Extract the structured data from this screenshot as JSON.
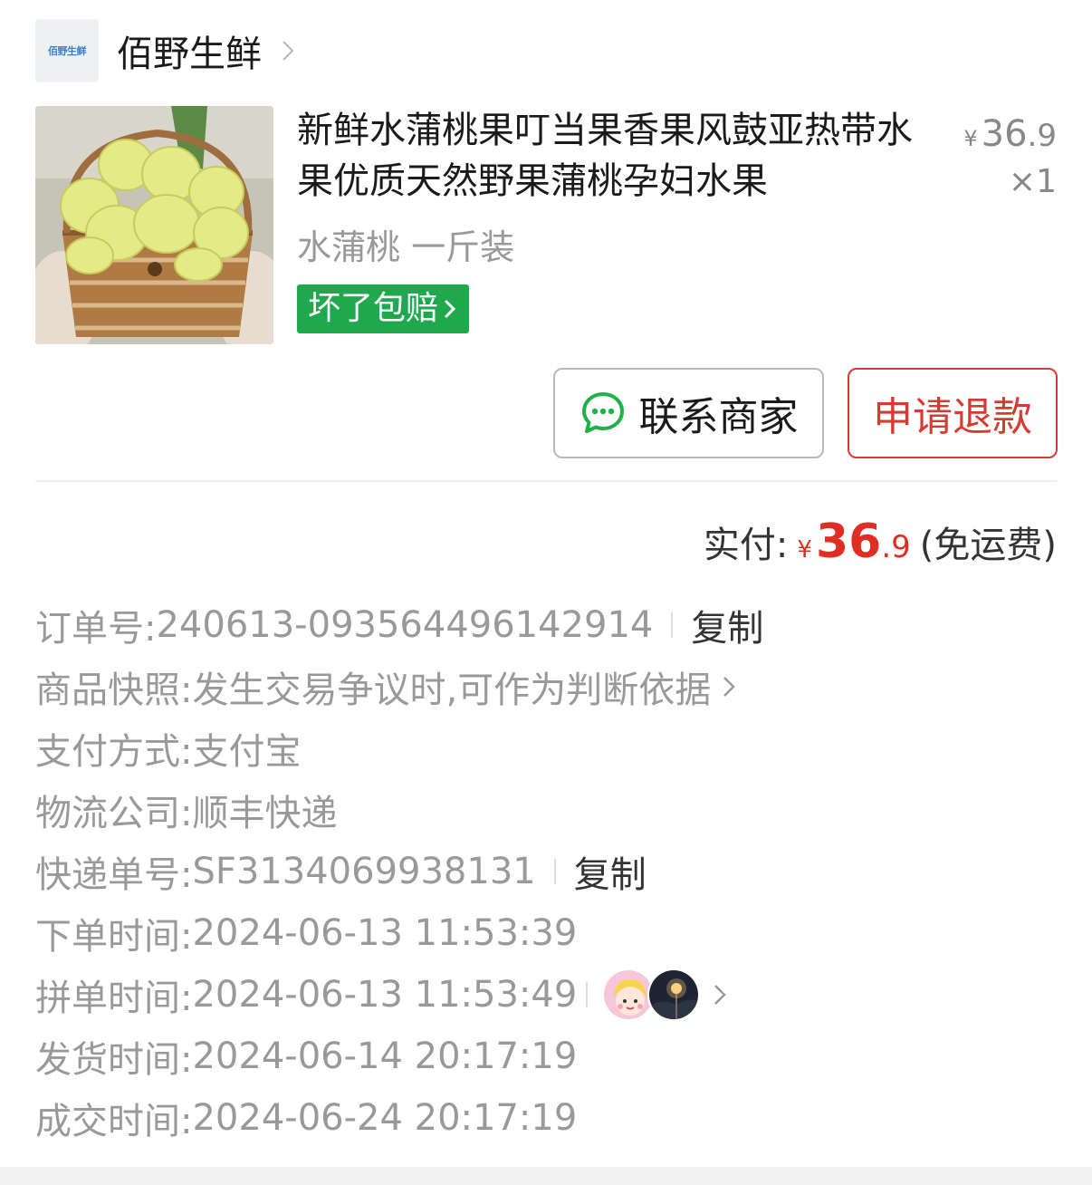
{
  "store": {
    "logo_text": "佰野生鲜",
    "name": "佰野生鲜"
  },
  "product": {
    "title": "新鲜水蒲桃果叮当果香果风鼓亚热带水果优质天然野果蒲桃孕妇水果",
    "price_yen": "¥",
    "price_int": "36",
    "price_dec": ".9",
    "quantity": "×1",
    "spec": "水蒲桃 一斤装",
    "guarantee": "坏了包赔"
  },
  "actions": {
    "contact": "联系商家",
    "refund": "申请退款"
  },
  "payment": {
    "label": "实付:",
    "yen": "¥",
    "int": "36",
    "dec": ".9",
    "note": "(免运费)"
  },
  "info": {
    "order_no_label": "订单号:",
    "order_no": "240613-093564496142914",
    "copy": "复制",
    "snapshot_label": "商品快照:",
    "snapshot_value": "发生交易争议时,可作为判断依据",
    "pay_method_label": "支付方式:",
    "pay_method": "支付宝",
    "logistics_label": "物流公司:",
    "logistics": "顺丰快递",
    "tracking_label": "快递单号:",
    "tracking": "SF3134069938131",
    "order_time_label": "下单时间:",
    "order_time": "2024-06-13 11:53:39",
    "group_time_label": "拼单时间:",
    "group_time": "2024-06-13 11:53:49",
    "ship_time_label": "发货时间:",
    "ship_time": "2024-06-14 20:17:19",
    "deal_time_label": "成交时间:",
    "deal_time": "2024-06-24 20:17:19"
  },
  "colors": {
    "accent_red": "#e02e24",
    "guarantee_green": "#1fa84d",
    "muted_gray": "#999999"
  }
}
